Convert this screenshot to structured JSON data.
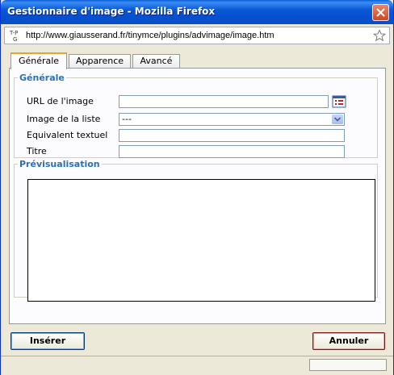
{
  "window": {
    "title": "Gestionnaire d'image - Mozilla Firefox"
  },
  "urlbar": {
    "site_icon_text": "T-P G",
    "url": "http://www.giausserand.fr/tinymce/plugins/advimage/image.htm"
  },
  "tabs": [
    {
      "label": "Générale",
      "active": true
    },
    {
      "label": "Apparence",
      "active": false
    },
    {
      "label": "Avancé",
      "active": false
    }
  ],
  "general": {
    "legend": "Générale",
    "url_label": "URL de l'image",
    "url_value": "",
    "list_label": "Image de la liste",
    "list_selected": "---",
    "alt_label": "Equivalent textuel",
    "alt_value": "",
    "title_label": "Titre",
    "title_value": ""
  },
  "preview": {
    "legend": "Prévisualisation"
  },
  "buttons": {
    "insert": "Insérer",
    "cancel": "Annuler"
  },
  "icons": {
    "close": "close-icon",
    "star": "star-icon",
    "browse": "browse-icon",
    "dropdown": "chevron-down-icon"
  },
  "colors": {
    "titlebar": "#0a58d6",
    "legend": "#2b6fb6",
    "active_tab": "#e6a42a"
  }
}
